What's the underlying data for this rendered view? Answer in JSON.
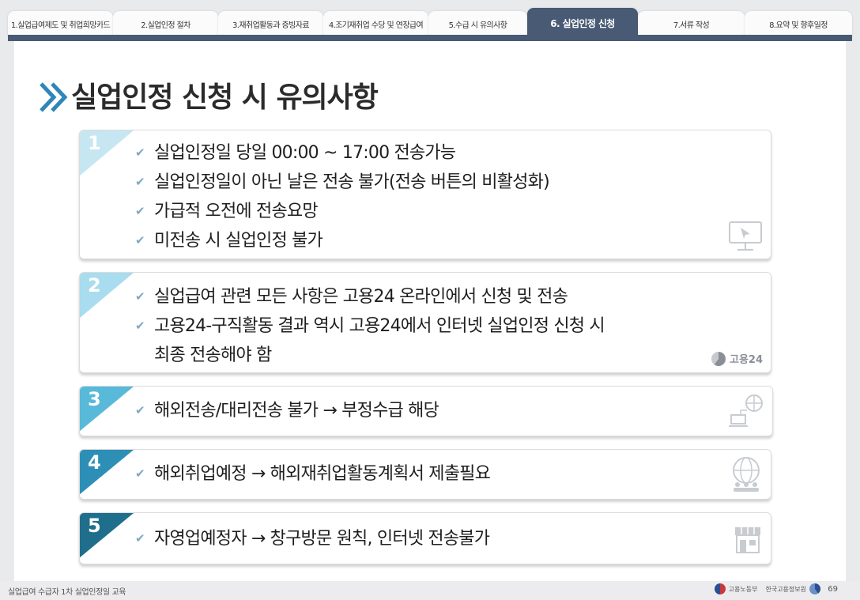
{
  "tabs": [
    {
      "label": "1.실업급여제도 및 취업희망카드",
      "active": false
    },
    {
      "label": "2.실업인정 절차",
      "active": false
    },
    {
      "label": "3.재취업활동과 증빙자료",
      "active": false
    },
    {
      "label": "4.조기재취업 수당 및 연장급여",
      "active": false
    },
    {
      "label": "5.수급 시 유의사항",
      "active": false
    },
    {
      "label": "6. 실업인정 신청",
      "active": true
    },
    {
      "label": "7.서류 작성",
      "active": false
    },
    {
      "label": "8.요약 및 향후일정",
      "active": false
    }
  ],
  "title": "실업인정 신청 시 유의사항",
  "cards": [
    {
      "number": "1",
      "lines": [
        "실업인정일 당일 00:00 ~ 17:00 전송가능",
        "실업인정일이 아닌 날은 전송 불가(전송 버튼의 비활성화)",
        "가급적 오전에 전송요망",
        "미전송 시 실업인정 불가"
      ],
      "icon": "monitor-icon"
    },
    {
      "number": "2",
      "lines": [
        "실업급여 관련 모든 사항은 고용24 온라인에서 신청 및 전송",
        "고용24-구직활동 결과 역시 고용24에서 인터넷 실업인정 신청 시"
      ],
      "continuation": "최종 전송해야 함",
      "logo_text": "고용24",
      "icon": "goyong24-logo-icon"
    },
    {
      "number": "3",
      "lines": [
        "해외전송/대리전송 불가 → 부정수급 해당"
      ],
      "icon": "laptop-globe-icon"
    },
    {
      "number": "4",
      "lines": [
        "해외취업예정 → 해외재취업활동계획서 제출필요"
      ],
      "icon": "globe-people-icon"
    },
    {
      "number": "5",
      "lines": [
        "자영업예정자 → 창구방문 원칙, 인터넷 전송불가"
      ],
      "icon": "store-icon"
    }
  ],
  "footer": {
    "text": "실업급여 수급자 1차 실업인정일 교육",
    "ministry": "고용노동부",
    "agency": "한국고용정보원",
    "page": "69"
  },
  "colors": {
    "tab_active": "#485a74",
    "num1": "#c6e6f2",
    "num2": "#a8dcee",
    "num3": "#58b9d9",
    "num4": "#2e8fb6",
    "num5": "#1f6f8c",
    "title_chevron": "#2f86b8"
  }
}
